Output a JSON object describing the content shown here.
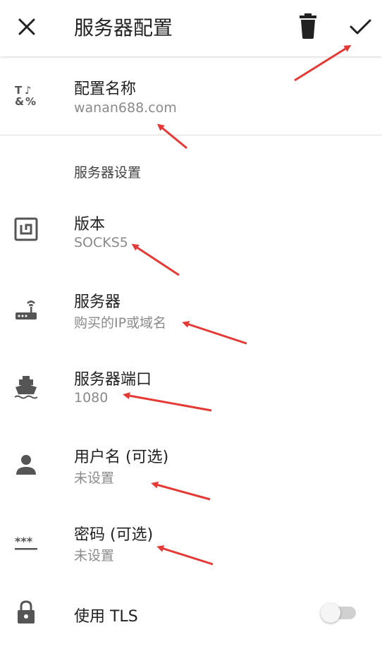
{
  "appbar": {
    "title": "服务器配置",
    "close_icon": "close-icon",
    "delete_icon": "trash-icon",
    "save_icon": "check-icon"
  },
  "profile_name": {
    "label": "配置名称",
    "value": "wanan688.com",
    "icon": "text-format-icon"
  },
  "server_settings_header": "服务器设置",
  "version": {
    "label": "版本",
    "value": "SOCKS5",
    "icon": "nfc-icon"
  },
  "server": {
    "label": "服务器",
    "value": "购买的IP或域名",
    "icon": "router-icon"
  },
  "port": {
    "label": "服务器端口",
    "value": "1080",
    "icon": "ship-icon"
  },
  "username": {
    "label": "用户名 (可选)",
    "value": "未设置",
    "icon": "person-icon"
  },
  "password": {
    "label": "密码 (可选)",
    "value": "未设置",
    "icon": "password-icon"
  },
  "tls": {
    "label": "使用 TLS",
    "icon": "lock-icon",
    "enabled": false
  },
  "colors": {
    "annotation_arrow": "#e53935",
    "primary_text": "#212121",
    "secondary_text": "#8a8a8a",
    "icon": "#555555"
  }
}
